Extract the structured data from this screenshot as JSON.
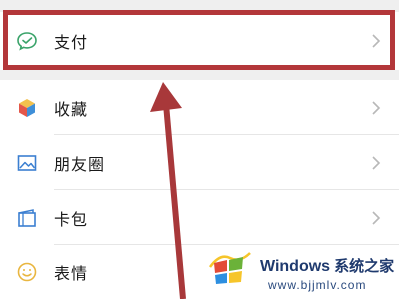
{
  "menu": {
    "items": [
      {
        "id": "pay",
        "label": "支付",
        "icon": "pay-icon"
      },
      {
        "id": "favorites",
        "label": "收藏",
        "icon": "favorites-cube-icon"
      },
      {
        "id": "moments",
        "label": "朋友圈",
        "icon": "photo-icon"
      },
      {
        "id": "cards",
        "label": "卡包",
        "icon": "wallet-icon"
      },
      {
        "id": "stickers",
        "label": "表情",
        "icon": "smiley-icon"
      }
    ]
  },
  "watermark": {
    "title": "Windows",
    "title_zh": "系统之家",
    "url": "www.bjjmlv.com"
  },
  "colors": {
    "highlight": "#b3373a",
    "pay_green": "#3aa36a",
    "watermark_blue": "#1f3a6e"
  }
}
